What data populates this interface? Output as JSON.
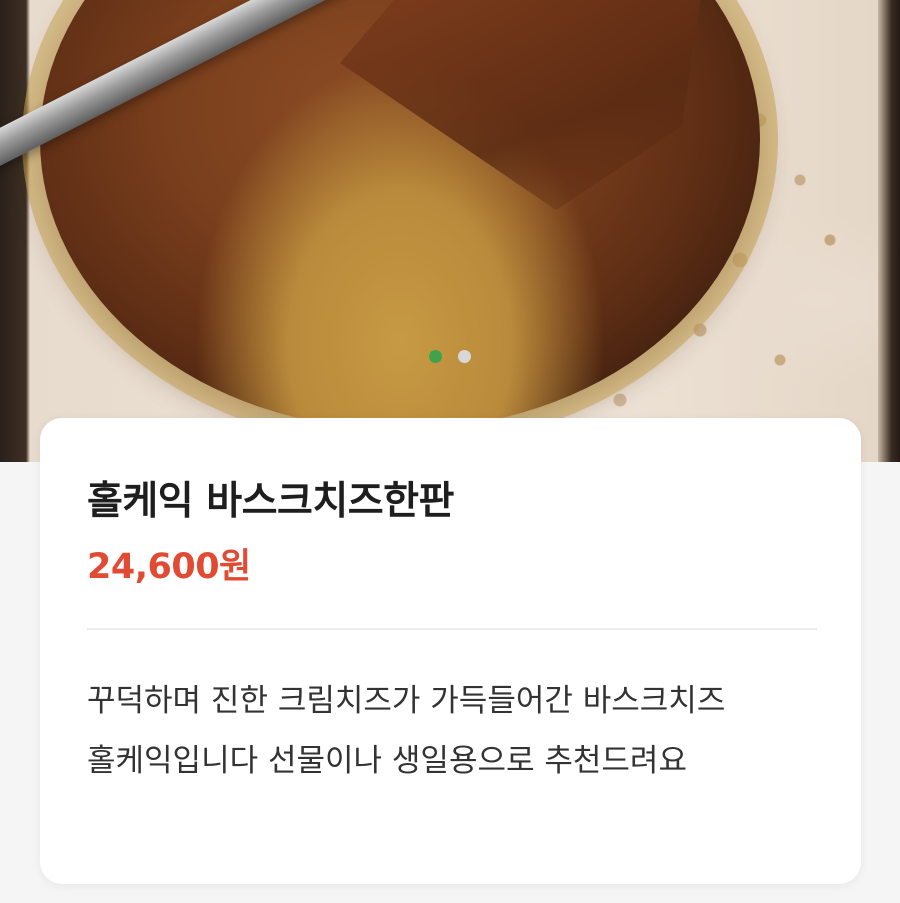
{
  "carousel": {
    "image_alt": "홀케익 바스크치즈한판",
    "total": 2,
    "active_index": 0
  },
  "product": {
    "title": "홀케익 바스크치즈한판",
    "price": "24,600원",
    "description": "꾸덕하며 진한 크림치즈가 가득들어간 바스크치즈 홀케익입니다 선물이나 생일용으로 추천드려요"
  },
  "colors": {
    "price": "#e24b33",
    "dot_active": "#3fa34d",
    "dot_inactive": "#d8d8d8"
  }
}
